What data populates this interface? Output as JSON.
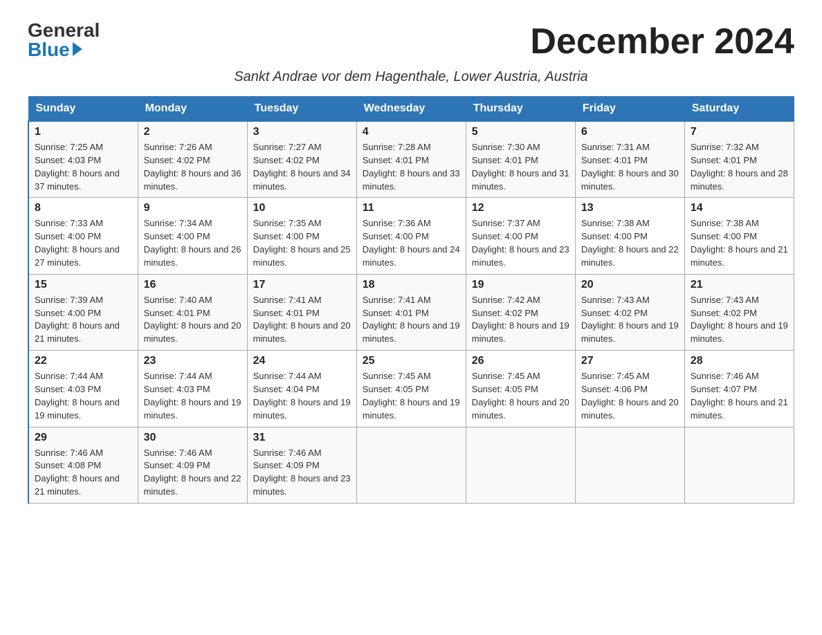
{
  "header": {
    "logo_general": "General",
    "logo_blue": "Blue",
    "month_title": "December 2024",
    "subtitle": "Sankt Andrae vor dem Hagenthale, Lower Austria, Austria"
  },
  "days_of_week": [
    "Sunday",
    "Monday",
    "Tuesday",
    "Wednesday",
    "Thursday",
    "Friday",
    "Saturday"
  ],
  "weeks": [
    [
      {
        "day": "1",
        "sunrise": "7:25 AM",
        "sunset": "4:03 PM",
        "daylight": "8 hours and 37 minutes."
      },
      {
        "day": "2",
        "sunrise": "7:26 AM",
        "sunset": "4:02 PM",
        "daylight": "8 hours and 36 minutes."
      },
      {
        "day": "3",
        "sunrise": "7:27 AM",
        "sunset": "4:02 PM",
        "daylight": "8 hours and 34 minutes."
      },
      {
        "day": "4",
        "sunrise": "7:28 AM",
        "sunset": "4:01 PM",
        "daylight": "8 hours and 33 minutes."
      },
      {
        "day": "5",
        "sunrise": "7:30 AM",
        "sunset": "4:01 PM",
        "daylight": "8 hours and 31 minutes."
      },
      {
        "day": "6",
        "sunrise": "7:31 AM",
        "sunset": "4:01 PM",
        "daylight": "8 hours and 30 minutes."
      },
      {
        "day": "7",
        "sunrise": "7:32 AM",
        "sunset": "4:01 PM",
        "daylight": "8 hours and 28 minutes."
      }
    ],
    [
      {
        "day": "8",
        "sunrise": "7:33 AM",
        "sunset": "4:00 PM",
        "daylight": "8 hours and 27 minutes."
      },
      {
        "day": "9",
        "sunrise": "7:34 AM",
        "sunset": "4:00 PM",
        "daylight": "8 hours and 26 minutes."
      },
      {
        "day": "10",
        "sunrise": "7:35 AM",
        "sunset": "4:00 PM",
        "daylight": "8 hours and 25 minutes."
      },
      {
        "day": "11",
        "sunrise": "7:36 AM",
        "sunset": "4:00 PM",
        "daylight": "8 hours and 24 minutes."
      },
      {
        "day": "12",
        "sunrise": "7:37 AM",
        "sunset": "4:00 PM",
        "daylight": "8 hours and 23 minutes."
      },
      {
        "day": "13",
        "sunrise": "7:38 AM",
        "sunset": "4:00 PM",
        "daylight": "8 hours and 22 minutes."
      },
      {
        "day": "14",
        "sunrise": "7:38 AM",
        "sunset": "4:00 PM",
        "daylight": "8 hours and 21 minutes."
      }
    ],
    [
      {
        "day": "15",
        "sunrise": "7:39 AM",
        "sunset": "4:00 PM",
        "daylight": "8 hours and 21 minutes."
      },
      {
        "day": "16",
        "sunrise": "7:40 AM",
        "sunset": "4:01 PM",
        "daylight": "8 hours and 20 minutes."
      },
      {
        "day": "17",
        "sunrise": "7:41 AM",
        "sunset": "4:01 PM",
        "daylight": "8 hours and 20 minutes."
      },
      {
        "day": "18",
        "sunrise": "7:41 AM",
        "sunset": "4:01 PM",
        "daylight": "8 hours and 19 minutes."
      },
      {
        "day": "19",
        "sunrise": "7:42 AM",
        "sunset": "4:02 PM",
        "daylight": "8 hours and 19 minutes."
      },
      {
        "day": "20",
        "sunrise": "7:43 AM",
        "sunset": "4:02 PM",
        "daylight": "8 hours and 19 minutes."
      },
      {
        "day": "21",
        "sunrise": "7:43 AM",
        "sunset": "4:02 PM",
        "daylight": "8 hours and 19 minutes."
      }
    ],
    [
      {
        "day": "22",
        "sunrise": "7:44 AM",
        "sunset": "4:03 PM",
        "daylight": "8 hours and 19 minutes."
      },
      {
        "day": "23",
        "sunrise": "7:44 AM",
        "sunset": "4:03 PM",
        "daylight": "8 hours and 19 minutes."
      },
      {
        "day": "24",
        "sunrise": "7:44 AM",
        "sunset": "4:04 PM",
        "daylight": "8 hours and 19 minutes."
      },
      {
        "day": "25",
        "sunrise": "7:45 AM",
        "sunset": "4:05 PM",
        "daylight": "8 hours and 19 minutes."
      },
      {
        "day": "26",
        "sunrise": "7:45 AM",
        "sunset": "4:05 PM",
        "daylight": "8 hours and 20 minutes."
      },
      {
        "day": "27",
        "sunrise": "7:45 AM",
        "sunset": "4:06 PM",
        "daylight": "8 hours and 20 minutes."
      },
      {
        "day": "28",
        "sunrise": "7:46 AM",
        "sunset": "4:07 PM",
        "daylight": "8 hours and 21 minutes."
      }
    ],
    [
      {
        "day": "29",
        "sunrise": "7:46 AM",
        "sunset": "4:08 PM",
        "daylight": "8 hours and 21 minutes."
      },
      {
        "day": "30",
        "sunrise": "7:46 AM",
        "sunset": "4:09 PM",
        "daylight": "8 hours and 22 minutes."
      },
      {
        "day": "31",
        "sunrise": "7:46 AM",
        "sunset": "4:09 PM",
        "daylight": "8 hours and 23 minutes."
      },
      null,
      null,
      null,
      null
    ]
  ]
}
